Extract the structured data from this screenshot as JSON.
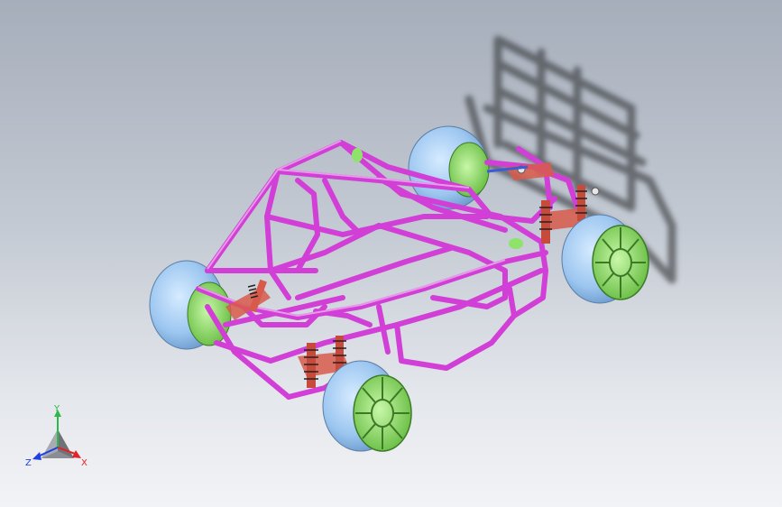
{
  "colors": {
    "frame": "#d23fd6",
    "tire": "#9cc6f0",
    "rim": "#8ee36a",
    "shock": "#d85a4a",
    "shadow": "#3a3c41",
    "axis_x": "#e0242a",
    "axis_y": "#2db84a",
    "axis_z": "#1f3fe0"
  },
  "triad": {
    "x_label": "X",
    "y_label": "Y",
    "z_label": "Z",
    "x_icon": "x-axis-arrow",
    "y_icon": "y-axis-arrow",
    "z_icon": "z-axis-arrow"
  }
}
